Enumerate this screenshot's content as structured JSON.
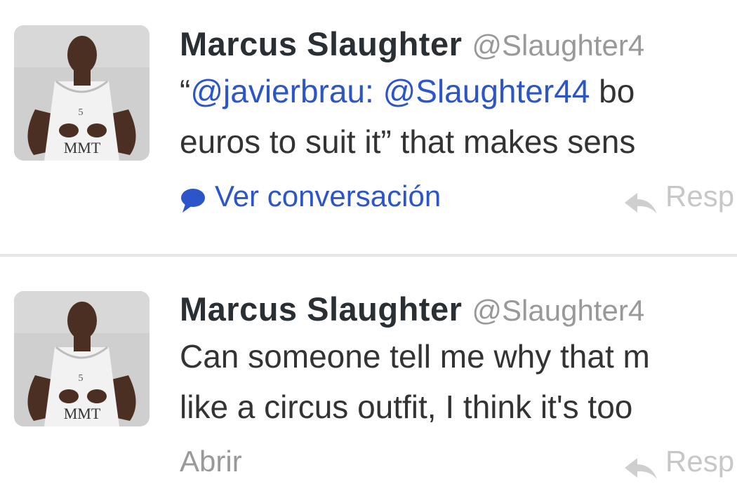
{
  "tweets": [
    {
      "fullname": "Marcus Slaughter",
      "username": "@Slaughter4",
      "text_lines": [
        {
          "quote_open": "“",
          "mention_1": "@javierbrau:",
          "mention_2": "@Slaughter44",
          "rest": " bo"
        },
        {
          "text": "euros to suit it” that makes sens"
        }
      ],
      "expand_label": "Ver conversación",
      "reply_label": "Resp",
      "avatar_jersey_text": "MMT"
    },
    {
      "fullname": "Marcus Slaughter",
      "username": "@Slaughter4",
      "text_lines": [
        {
          "text": "Can someone tell me why that m"
        },
        {
          "text": "like a circus outfit, I think it's too"
        }
      ],
      "expand_label": "Abrir",
      "reply_label": "Resp",
      "avatar_jersey_text": "MMT"
    }
  ],
  "icons": {
    "conversation": "speech-bubble-icon",
    "reply": "reply-arrow-icon"
  },
  "colors": {
    "link": "#2b55c8",
    "name": "#292f33",
    "muted": "#999999",
    "divider": "#e6e6e6"
  }
}
